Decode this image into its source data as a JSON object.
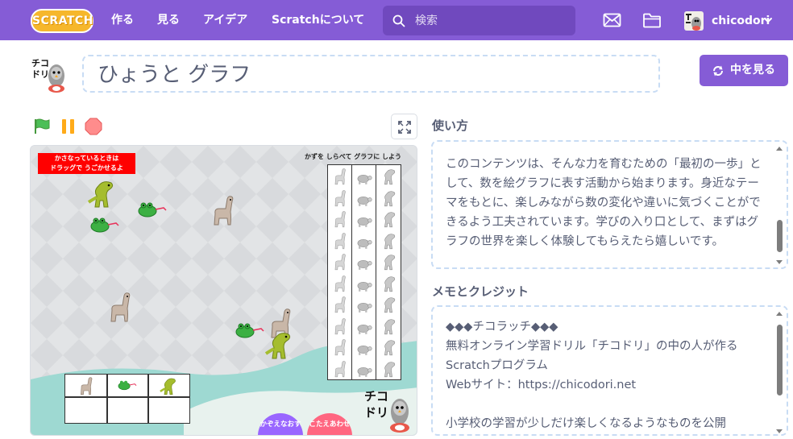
{
  "nav": {
    "logo": "SCRATCH",
    "items": [
      "作る",
      "見る",
      "アイデア",
      "Scratchについて"
    ],
    "search_placeholder": "検索",
    "username": "chicodori"
  },
  "project": {
    "title": "ひょうと グラフ",
    "see_inside": "中を見る",
    "avatar_text": "チコドリ"
  },
  "stage": {
    "red_note_line1": "かさなっているときは",
    "red_note_line2": "ドラッグで うごかせるよ",
    "graph_title": "かずを しらべて グラフに しよう",
    "button_count": "かぞえなおす",
    "button_check": "こたえあわせ",
    "mascot_text": "チコドリ",
    "graph_columns": [
      "llama-icon",
      "turtle-icon",
      "dinosaur-icon"
    ],
    "graph_rows": 10
  },
  "instructions": {
    "title": "使い方",
    "text": "このコンテンツは、そんな力を育むための「最初の一歩」として、数を絵グラフに表す活動から始まります。身近なテーマをもとに、楽しみながら数の変化や違いに気づくことができるよう工夫されています。学びの入り口として、まずはグラフの世界を楽しく体験してもらえたら嬉しいです。"
  },
  "notes": {
    "title": "メモとクレジット",
    "text": "◆◆◆チコラッチ◆◆◆\n無料オンライン学習ドリル「チコドリ」の中の人が作るScratchプログラム\nWebサイト：https://chicodori.net\n\n小学校の学習が少しだけ楽しくなるようなものを公開"
  },
  "colors": {
    "brand": "#855cd6",
    "search_bg": "#7049be",
    "flag": "#4cbf56",
    "pause": "#ffab19",
    "stop": "#ff8c8c",
    "note_red": "#ff0000",
    "count_button": "#9966ff",
    "check_button": "#ff6680"
  }
}
